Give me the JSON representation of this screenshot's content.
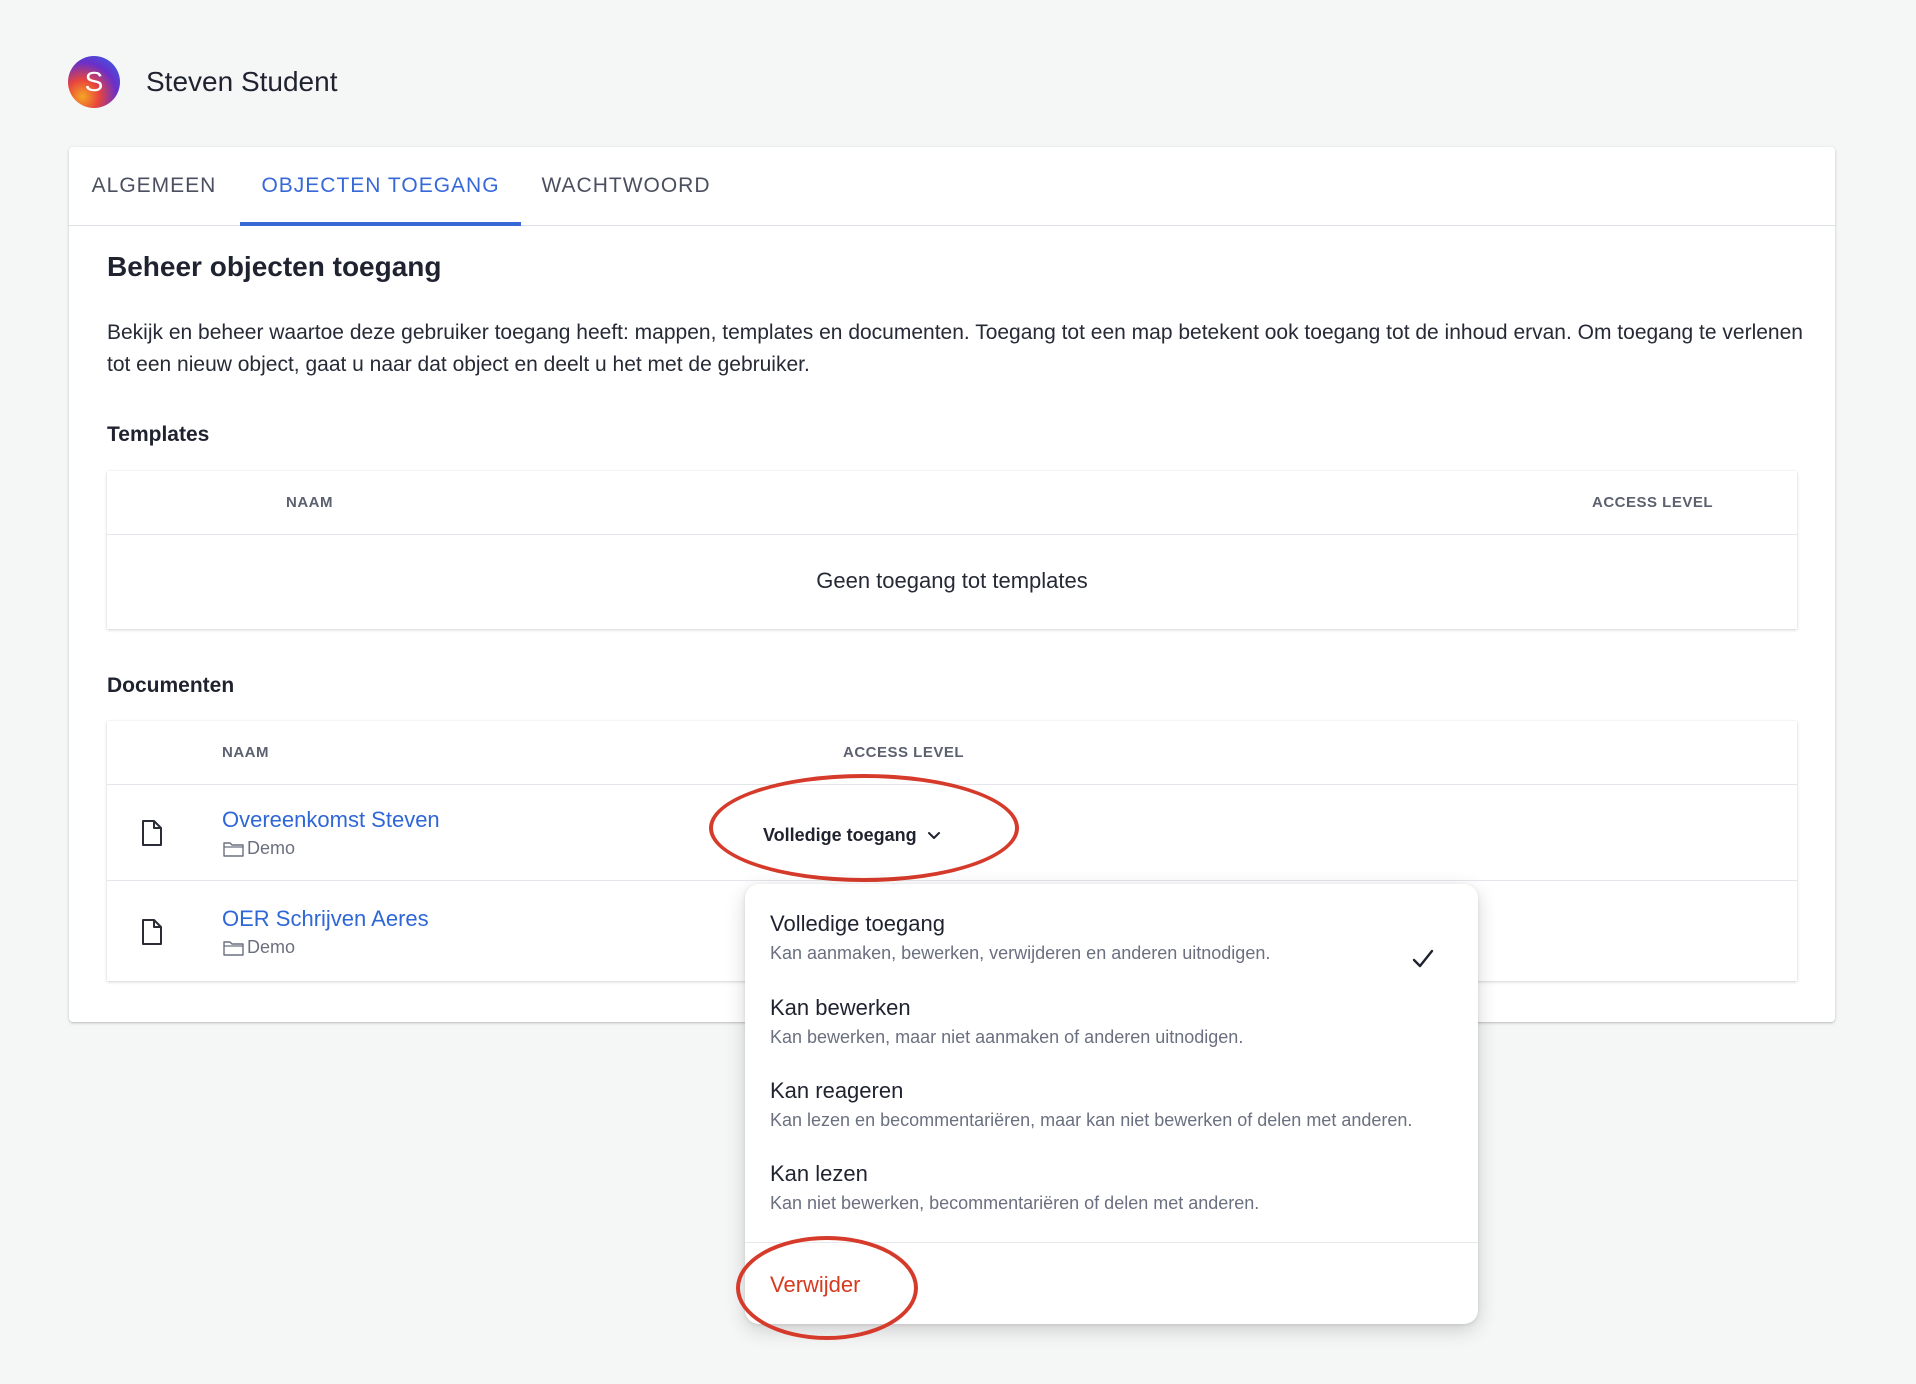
{
  "user": {
    "avatar_initial": "S",
    "name": "Steven Student"
  },
  "tabs": [
    {
      "label": "ALGEMEEN",
      "active": false
    },
    {
      "label": "OBJECTEN TOEGANG",
      "active": true
    },
    {
      "label": "WACHTWOORD",
      "active": false
    }
  ],
  "heading": "Beheer objecten toegang",
  "description": "Bekijk en beheer waartoe deze gebruiker toegang heeft: mappen, templates en documenten. Toegang tot een map betekent ook toegang tot de inhoud ervan. Om toegang te verlenen tot een nieuw object, gaat u naar dat object en deelt u het met de gebruiker.",
  "templates": {
    "title": "Templates",
    "col_name": "NAAM",
    "col_access": "ACCESS LEVEL",
    "empty_message": "Geen toegang tot templates"
  },
  "documents": {
    "title": "Documenten",
    "col_name": "NAAM",
    "col_access": "ACCESS LEVEL",
    "rows": [
      {
        "name": "Overeenkomst Steven",
        "folder": "Demo",
        "access": "Volledige toegang"
      },
      {
        "name": "OER Schrijven Aeres",
        "folder": "Demo"
      }
    ]
  },
  "access_menu": {
    "options": [
      {
        "title": "Volledige toegang",
        "description": "Kan aanmaken, bewerken, verwijderen en anderen uitnodigen.",
        "selected": true
      },
      {
        "title": "Kan bewerken",
        "description": "Kan bewerken, maar niet aanmaken of anderen uitnodigen.",
        "selected": false
      },
      {
        "title": "Kan reageren",
        "description": "Kan lezen en becommentariëren, maar kan niet bewerken of delen met anderen.",
        "selected": false
      },
      {
        "title": "Kan lezen",
        "description": "Kan niet bewerken, becommentariëren of delen met anderen.",
        "selected": false
      }
    ],
    "delete_label": "Verwijder"
  },
  "colors": {
    "accent": "#3768d8",
    "link": "#2f67d7",
    "danger": "#d63a1f",
    "annotation": "#d63a2a"
  }
}
